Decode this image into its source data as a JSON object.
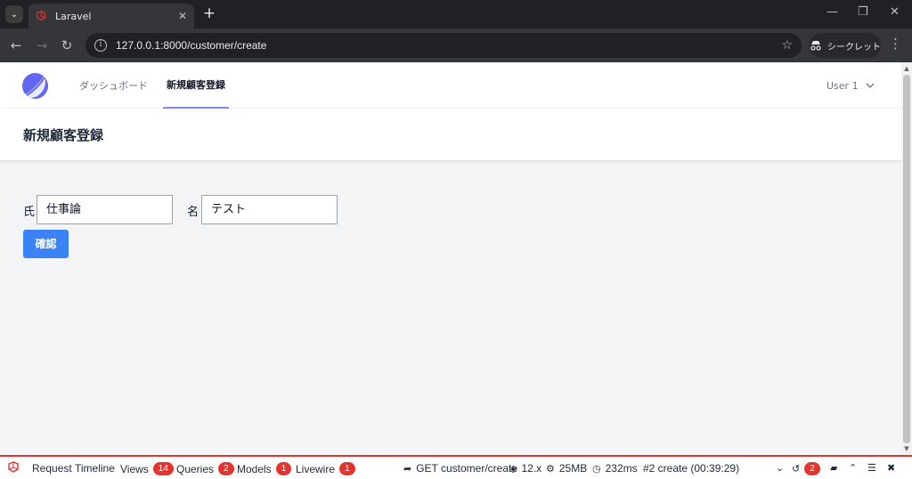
{
  "browser": {
    "tab_title": "Laravel",
    "url": "127.0.0.1:8000/customer/create",
    "incognito_label": "シークレット"
  },
  "nav": {
    "dashboard": "ダッシュボード",
    "new_customer": "新規顧客登録",
    "user": "User 1"
  },
  "page": {
    "heading": "新規顧客登録",
    "last_name_label": "氏",
    "last_name_value": "仕事論",
    "first_name_label": "名",
    "first_name_value": "テスト",
    "confirm_button": "確認"
  },
  "debugbar": {
    "request": "Request",
    "timeline": "Timeline",
    "views": "Views",
    "views_count": "14",
    "queries": "Queries",
    "queries_count": "2",
    "models": "Models",
    "models_count": "1",
    "livewire": "Livewire",
    "livewire_count": "1",
    "route": "GET customer/create",
    "version": "12.x",
    "memory": "25MB",
    "time": "232ms",
    "request_info": "#2 create (00:39:29)",
    "history_count": "2"
  },
  "colors": {
    "accent": "#3b82f6",
    "nav_underline": "#818cf8",
    "debug_red": "#e3342f"
  }
}
